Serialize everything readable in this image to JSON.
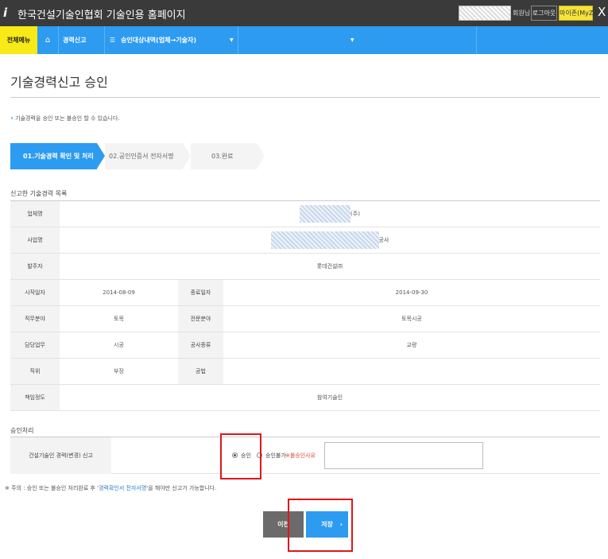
{
  "titlebar": {
    "title": "한국건설기술인협회 기술인용 홈페이지",
    "greeting": "회원님!",
    "logout": "로그아웃",
    "myzone": "마이존(MyZone)",
    "close": "X"
  },
  "nav": {
    "all_menu": "전체메뉴",
    "home_icon": "⌂",
    "item1": "경력신고",
    "menu_icon": "☰",
    "item2": "승인대상내역(업체→기술자)",
    "caret": "▼"
  },
  "page": {
    "title": "기술경력신고 승인",
    "notice": "기술경력을 승인 또는 불승인 할 수 있습니다."
  },
  "steps": [
    "01.기술경력 확인 및 처리",
    "02.공인인증서 전자서명",
    "03.완료"
  ],
  "info": {
    "section_title": "신고한 기술경력 목록",
    "company_label": "업체명",
    "company_suffix": "(주)",
    "project_label": "사업명",
    "project_suffix": "공사",
    "client_label": "발주자",
    "client_value": "롯데건설㈜",
    "start_label": "시작일자",
    "start_value": "2014-08-09",
    "end_label": "종료일자",
    "end_value": "2014-09-30",
    "duty_label": "직무분야",
    "duty_value": "토목",
    "specialty_label": "전문분야",
    "specialty_value": "토목시공",
    "task_label": "담당업무",
    "task_value": "시공",
    "worktype_label": "공사종류",
    "worktype_value": "교량",
    "position_label": "직위",
    "position_value": "부장",
    "method_label": "공법",
    "method_value": "",
    "participation_label": "책임정도",
    "participation_value": "참여기술인"
  },
  "approval": {
    "section_title": "승인처리",
    "row_label": "건설기술인 경력(변경) 신고",
    "approve_label": "승인",
    "reject_label": "승인불가",
    "reason_label": "※불승인사유",
    "reason_value": ""
  },
  "hint": {
    "prefix": "※ 주의 : 승인 또는 불승인 처리완료 후 '",
    "link": "경력확인서 전자서명",
    "suffix": "'을 해야만 신고가 가능합니다."
  },
  "buttons": {
    "prev": "이전",
    "save": "저장",
    "save_chevron": "›"
  },
  "colors": {
    "accent": "#2d9bf0",
    "highlight": "#e0161b",
    "all_menu_bg": "#f7ea16"
  }
}
